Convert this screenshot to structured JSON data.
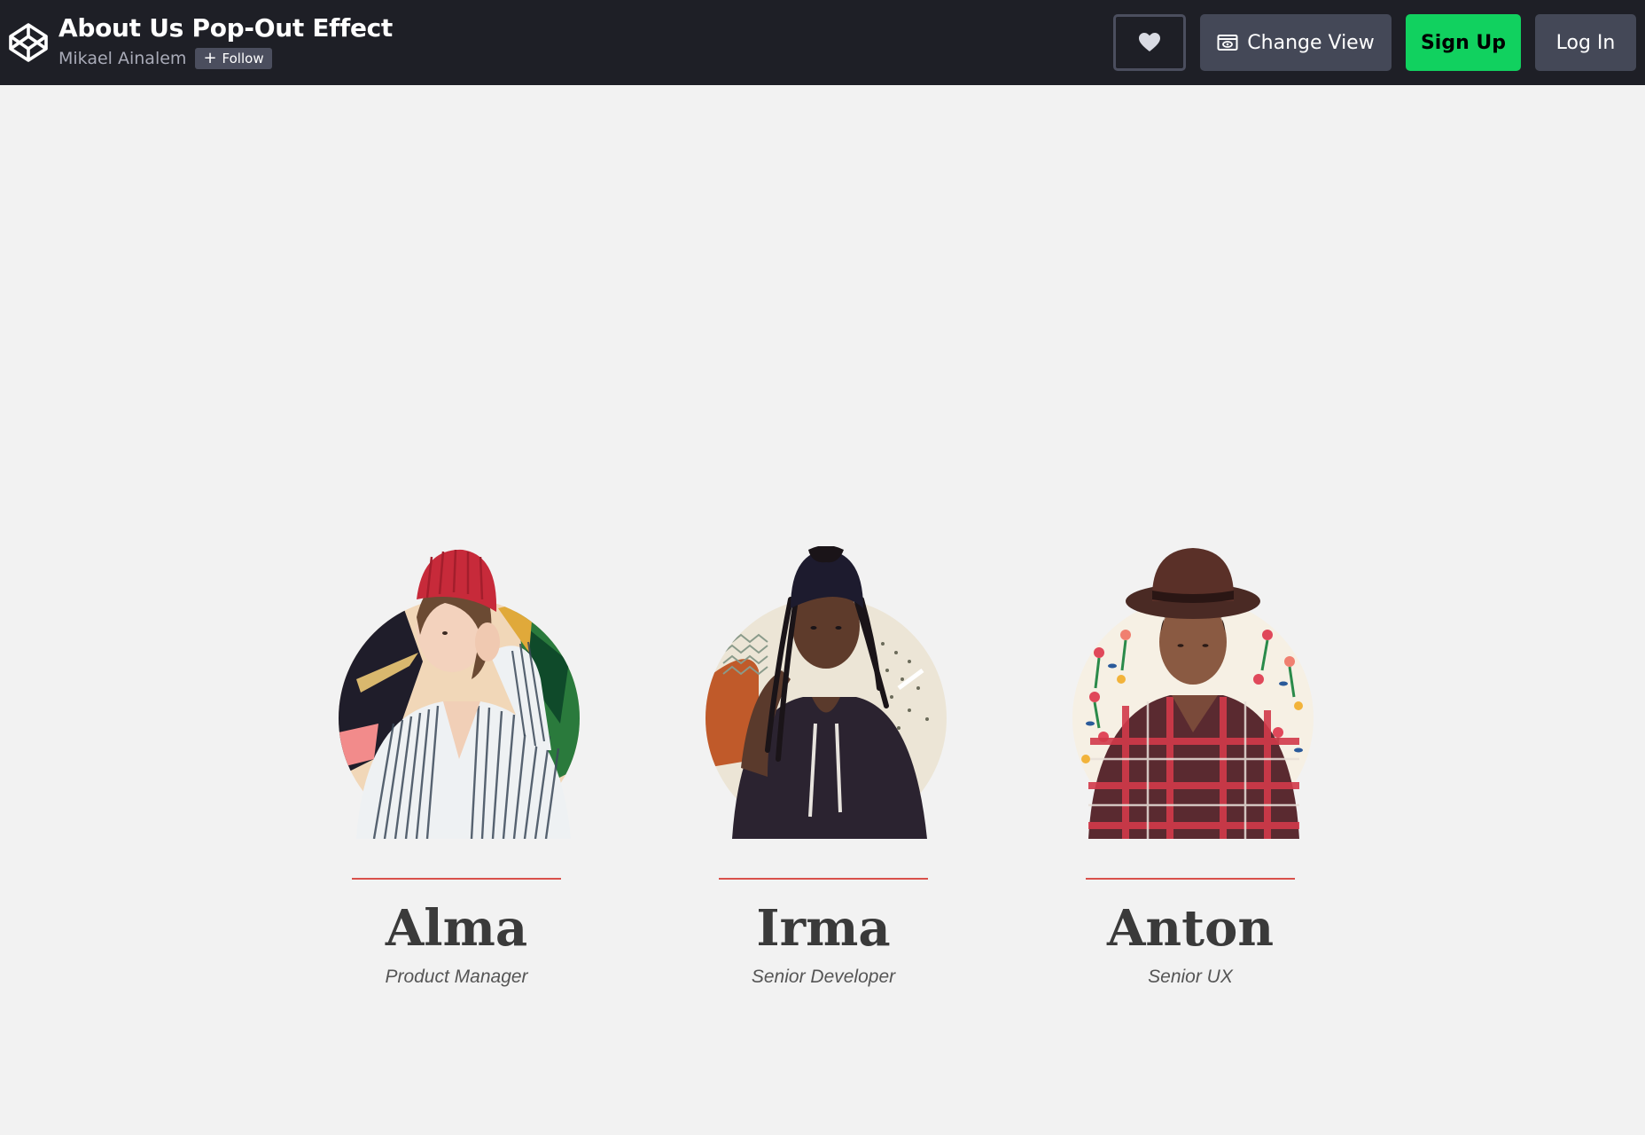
{
  "header": {
    "title": "About Us Pop-Out Effect",
    "author": "Mikael Ainalem",
    "follow_label": "Follow",
    "change_view_label": "Change View",
    "signup_label": "Sign Up",
    "login_label": "Log In"
  },
  "team": [
    {
      "name": "Alma",
      "role": "Product Manager"
    },
    {
      "name": "Irma",
      "role": "Senior Developer"
    },
    {
      "name": "Anton",
      "role": "Senior UX"
    }
  ],
  "colors": {
    "topbar": "#1e1f26",
    "signup": "#11d15f",
    "divider": "#d9514b",
    "background": "#f2f2f2"
  },
  "icons": [
    "codepen-logo-icon",
    "heart-icon",
    "change-view-icon",
    "plus-icon"
  ]
}
